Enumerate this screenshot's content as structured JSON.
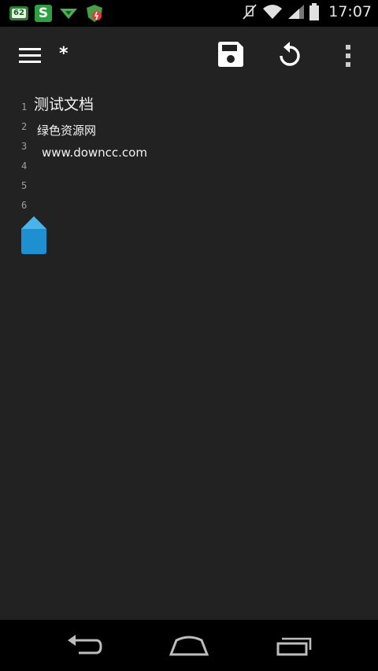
{
  "status_bar": {
    "badge_count": "62",
    "s_app_letter": "S",
    "time": "17:07"
  },
  "toolbar": {
    "title": "*",
    "icons": [
      "menu-icon",
      "save-icon",
      "undo-icon",
      "more-icon"
    ]
  },
  "editor": {
    "line_numbers": [
      "1",
      "2",
      "3",
      "4",
      "5",
      "6"
    ],
    "lines": [
      "测试文档",
      "绿色资源网",
      "www.downcc.com",
      "",
      "",
      ""
    ]
  },
  "nav_bar": {
    "icons": [
      "back-icon",
      "home-icon",
      "recents-icon"
    ]
  },
  "colors": {
    "background": "#222222",
    "status_bar": "#000000",
    "handle": "#1e90d2"
  }
}
